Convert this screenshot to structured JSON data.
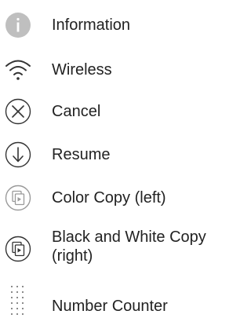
{
  "colors": {
    "text": "#222222",
    "icon_fill": "#bfbfbf",
    "icon_stroke": "#333333",
    "icon_light_stroke": "#9a9a9a",
    "background": "#ffffff"
  },
  "legend": {
    "items": [
      {
        "icon": "information-icon",
        "label": "Information"
      },
      {
        "icon": "wireless-icon",
        "label": "Wireless"
      },
      {
        "icon": "cancel-icon",
        "label": "Cancel"
      },
      {
        "icon": "resume-icon",
        "label": "Resume"
      },
      {
        "icon": "color-copy-icon",
        "label": "Color Copy (left)"
      },
      {
        "icon": "black-white-copy-icon",
        "label": "Black and White Copy (right)"
      },
      {
        "icon": "number-counter-icon",
        "label": "Number Counter"
      }
    ]
  }
}
